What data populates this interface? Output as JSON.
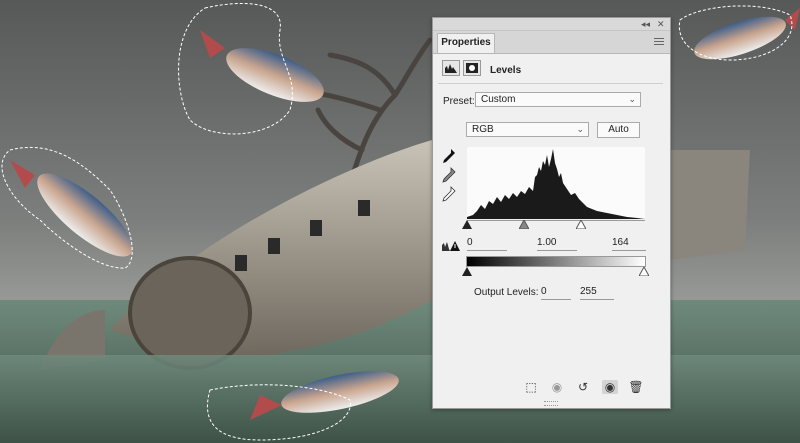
{
  "panel": {
    "tab_label": "Properties",
    "adjustment_title": "Levels",
    "preset_label": "Preset:",
    "preset_value": "Custom",
    "channel_value": "RGB",
    "auto_label": "Auto",
    "input_black": "0",
    "input_gamma": "1.00",
    "input_white": "164",
    "output_label": "Output Levels:",
    "output_black": "0",
    "output_white": "255"
  },
  "colors": {
    "panel_bg": "#f0f0f0",
    "histogram": "#1a1a1a",
    "sky": "#6b6d6c",
    "grass": "#5f7a6a"
  },
  "icons": {
    "header": [
      "levels-adjustment-icon",
      "mask-icon"
    ],
    "eyedroppers": [
      "black-point-eyedropper-icon",
      "gray-point-eyedropper-icon",
      "white-point-eyedropper-icon"
    ],
    "footer": [
      "clip-to-layer-icon",
      "view-previous-state-icon",
      "reset-icon",
      "toggle-visibility-icon",
      "delete-icon"
    ]
  }
}
